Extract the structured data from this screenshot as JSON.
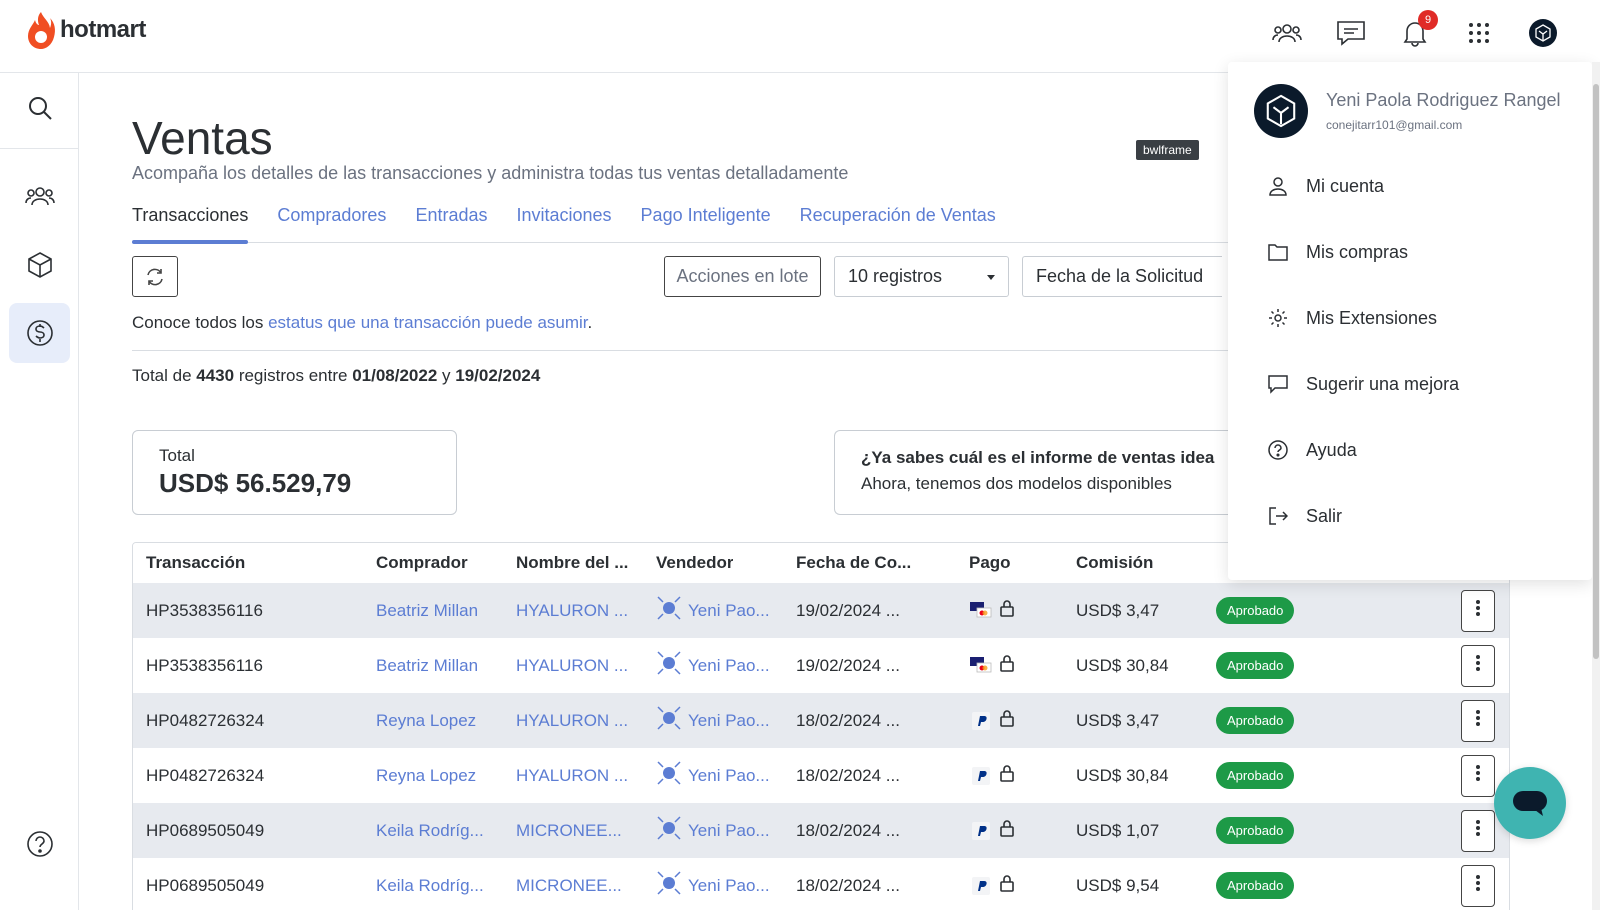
{
  "brand": {
    "name": "hotmart",
    "color": "#f04e23"
  },
  "topbar": {
    "notification_count": "9"
  },
  "tooltip": "bwlframe",
  "page": {
    "title": "Ventas",
    "subtitle": "Acompaña los detalles de las transacciones y administra todas tus ventas detalladamente"
  },
  "tabs": [
    {
      "label": "Transacciones",
      "active": true
    },
    {
      "label": "Compradores"
    },
    {
      "label": "Entradas"
    },
    {
      "label": "Invitaciones"
    },
    {
      "label": "Pago Inteligente"
    },
    {
      "label": "Recuperación de Ventas"
    }
  ],
  "toolbar": {
    "bulk_actions": "Acciones en lote",
    "page_size": "10 registros",
    "date_filter": "Fecha de la Solicitud"
  },
  "info": {
    "prefix": "Conoce todos los ",
    "link": "estatus que una transacción puede asumir",
    "suffix": "."
  },
  "summary": {
    "t1": "Total de ",
    "count": "4430",
    "t2": " registros entre ",
    "from": "01/08/2022",
    "t3": " y ",
    "to": "19/02/2024"
  },
  "total_card": {
    "label": "Total",
    "value": "USD$ 56.529,79"
  },
  "promo": {
    "question": "¿Ya sabes cuál es el informe de ventas idea",
    "answer": "Ahora, tenemos dos modelos disponibles"
  },
  "table": {
    "headers": [
      "Transacción",
      "Comprador",
      "Nombre del ...",
      "Vendedor",
      "Fecha de Co...",
      "Pago",
      "Comisión"
    ],
    "rows": [
      {
        "tx": "HP3538356116",
        "buyer": "Beatriz Millan",
        "product": "HYALURON ...",
        "seller": "Yeni Pao...",
        "date": "19/02/2024 ...",
        "pay": "card",
        "commission": "USD$ 3,47",
        "status": "Aprobado"
      },
      {
        "tx": "HP3538356116",
        "buyer": "Beatriz Millan",
        "product": "HYALURON ...",
        "seller": "Yeni Pao...",
        "date": "19/02/2024 ...",
        "pay": "card",
        "commission": "USD$ 30,84",
        "status": "Aprobado"
      },
      {
        "tx": "HP0482726324",
        "buyer": "Reyna Lopez",
        "product": "HYALURON ...",
        "seller": "Yeni Pao...",
        "date": "18/02/2024 ...",
        "pay": "paypal",
        "commission": "USD$ 3,47",
        "status": "Aprobado"
      },
      {
        "tx": "HP0482726324",
        "buyer": "Reyna Lopez",
        "product": "HYALURON ...",
        "seller": "Yeni Pao...",
        "date": "18/02/2024 ...",
        "pay": "paypal",
        "commission": "USD$ 30,84",
        "status": "Aprobado"
      },
      {
        "tx": "HP0689505049",
        "buyer": "Keila Rodríg...",
        "product": "MICRONEE...",
        "seller": "Yeni Pao...",
        "date": "18/02/2024 ...",
        "pay": "paypal",
        "commission": "USD$ 1,07",
        "status": "Aprobado"
      },
      {
        "tx": "HP0689505049",
        "buyer": "Keila Rodríg...",
        "product": "MICRONEE...",
        "seller": "Yeni Pao...",
        "date": "18/02/2024 ...",
        "pay": "paypal",
        "commission": "USD$ 9,54",
        "status": "Aprobado"
      }
    ]
  },
  "user_menu": {
    "name": "Yeni Paola Rodriguez Rangel",
    "email": "conejitarr101@gmail.com",
    "items": [
      {
        "label": "Mi cuenta",
        "icon": "user-icon"
      },
      {
        "label": "Mis compras",
        "icon": "folder-icon"
      },
      {
        "label": "Mis Extensiones",
        "icon": "gear-icon"
      },
      {
        "label": "Sugerir una mejora",
        "icon": "speech-bubble-icon"
      },
      {
        "label": "Ayuda",
        "icon": "help-circle-icon"
      },
      {
        "label": "Salir",
        "icon": "logout-icon"
      }
    ]
  }
}
